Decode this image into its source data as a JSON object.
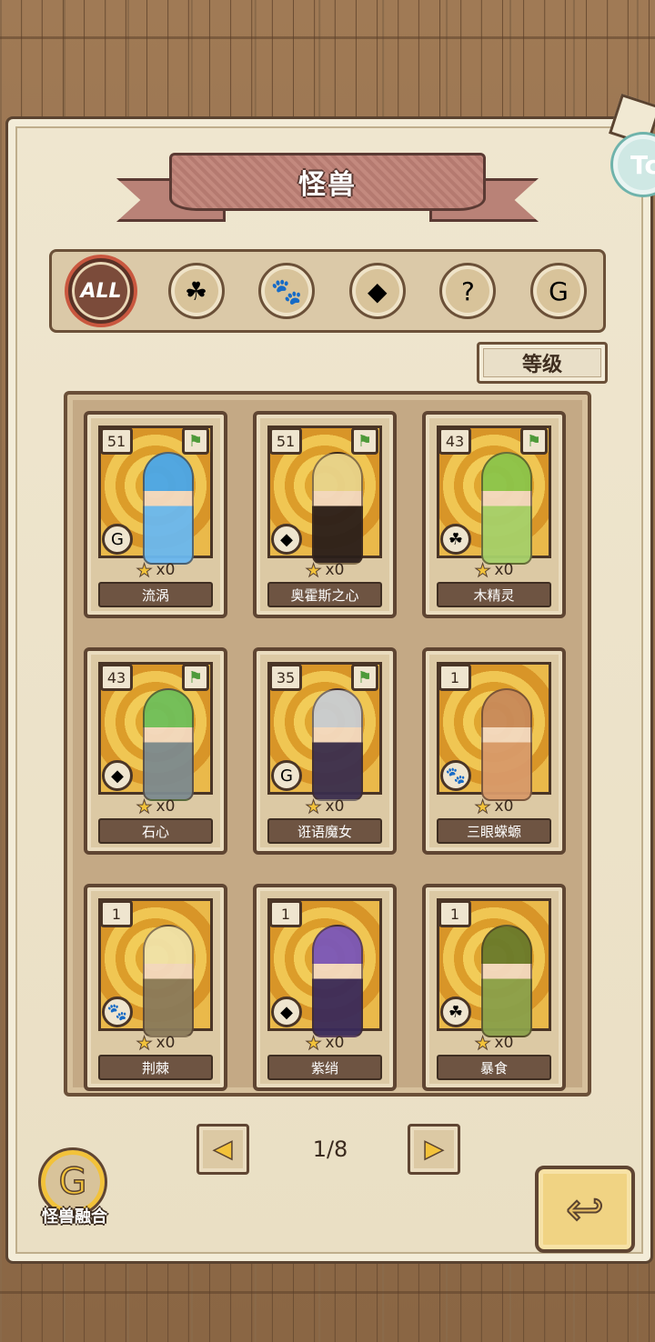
{
  "header": {
    "title": "怪兽",
    "corner_badge": "Tc"
  },
  "filters": [
    {
      "label": "ALL",
      "icon": "all-icon",
      "glyph": "ALL",
      "active": true
    },
    {
      "label": "",
      "icon": "clover-icon",
      "glyph": "☘"
    },
    {
      "label": "",
      "icon": "paw-icon",
      "glyph": "🐾"
    },
    {
      "label": "",
      "icon": "crystal-icon",
      "glyph": "◆"
    },
    {
      "label": "",
      "icon": "question-icon",
      "glyph": "?"
    },
    {
      "label": "",
      "icon": "spiral-icon",
      "glyph": "G"
    }
  ],
  "sort_button": {
    "label": "等级"
  },
  "cards": [
    {
      "level": "51",
      "name": "流涡",
      "count": "x0",
      "type_glyph": "G",
      "type_icon": "spiral-icon",
      "flag": true,
      "hair": "#4aa6e8",
      "body": "#6ab8f0"
    },
    {
      "level": "51",
      "name": "奥霍斯之心",
      "count": "x0",
      "type_glyph": "◆",
      "type_icon": "crystal-icon",
      "flag": true,
      "hair": "#e8d38a",
      "body": "#2a1e1a"
    },
    {
      "level": "43",
      "name": "木精灵",
      "count": "x0",
      "type_glyph": "☘",
      "type_icon": "clover-icon",
      "flag": true,
      "hair": "#8bc44a",
      "body": "#a6d06a"
    },
    {
      "level": "43",
      "name": "石心",
      "count": "x0",
      "type_glyph": "◆",
      "type_icon": "crystal-icon",
      "flag": true,
      "hair": "#6fbf5a",
      "body": "#7d8a8f"
    },
    {
      "level": "35",
      "name": "诳语魔女",
      "count": "x0",
      "type_glyph": "G",
      "type_icon": "spiral-icon",
      "flag": true,
      "hair": "#c8ccd2",
      "body": "#3a2e4e"
    },
    {
      "level": "1",
      "name": "三眼蝾螈",
      "count": "x0",
      "type_glyph": "🐾",
      "type_icon": "paw-icon",
      "flag": false,
      "hair": "#c88a5a",
      "body": "#d89a6a"
    },
    {
      "level": "1",
      "name": "荆棘",
      "count": "x0",
      "type_glyph": "🐾",
      "type_icon": "paw-icon",
      "flag": false,
      "hair": "#f0e2a8",
      "body": "#8a7a5a"
    },
    {
      "level": "1",
      "name": "紫绡",
      "count": "x0",
      "type_glyph": "◆",
      "type_icon": "crystal-icon",
      "flag": false,
      "hair": "#7a56b8",
      "body": "#3a2a5a"
    },
    {
      "level": "1",
      "name": "暴食",
      "count": "x0",
      "type_glyph": "☘",
      "type_icon": "clover-icon",
      "flag": false,
      "hair": "#6a7a2a",
      "body": "#8aa04a"
    }
  ],
  "pagination": {
    "indicator": "1/8",
    "prev_glyph": "◀",
    "next_glyph": "▶"
  },
  "fusion": {
    "label": "怪兽融合",
    "glyph": "G"
  },
  "back": {
    "glyph": "↩"
  }
}
